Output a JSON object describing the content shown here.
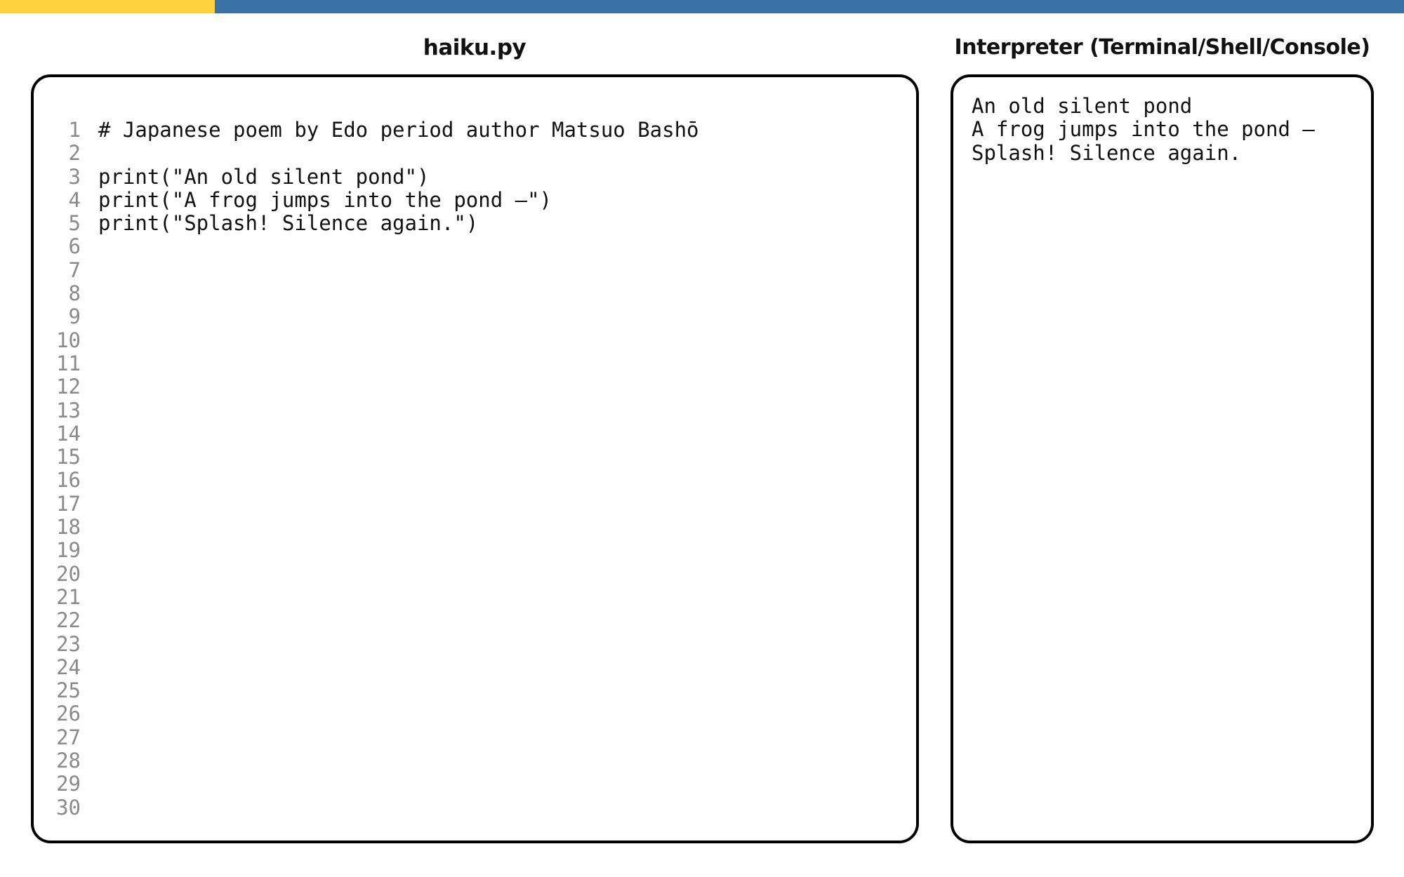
{
  "colors": {
    "top_bar": "#3a72a6",
    "top_bar_accent": "#fdd23d",
    "panel_border": "#000000",
    "line_number": "#8a8a8a",
    "text": "#111111"
  },
  "editor": {
    "title": "haiku.py",
    "lines": [
      {
        "num": "1",
        "code": "# Japanese poem by Edo period author Matsuo Bashō"
      },
      {
        "num": "2",
        "code": ""
      },
      {
        "num": "3",
        "code": "print(\"An old silent pond\")"
      },
      {
        "num": "4",
        "code": "print(\"A frog jumps into the pond —\")"
      },
      {
        "num": "5",
        "code": "print(\"Splash! Silence again.\")"
      },
      {
        "num": "6",
        "code": ""
      },
      {
        "num": "7",
        "code": ""
      },
      {
        "num": "8",
        "code": ""
      },
      {
        "num": "9",
        "code": ""
      },
      {
        "num": "10",
        "code": ""
      },
      {
        "num": "11",
        "code": ""
      },
      {
        "num": "12",
        "code": ""
      },
      {
        "num": "13",
        "code": ""
      },
      {
        "num": "14",
        "code": ""
      },
      {
        "num": "15",
        "code": ""
      },
      {
        "num": "16",
        "code": ""
      },
      {
        "num": "17",
        "code": ""
      },
      {
        "num": "18",
        "code": ""
      },
      {
        "num": "19",
        "code": ""
      },
      {
        "num": "20",
        "code": ""
      },
      {
        "num": "21",
        "code": ""
      },
      {
        "num": "22",
        "code": ""
      },
      {
        "num": "23",
        "code": ""
      },
      {
        "num": "24",
        "code": ""
      },
      {
        "num": "25",
        "code": ""
      },
      {
        "num": "26",
        "code": ""
      },
      {
        "num": "27",
        "code": ""
      },
      {
        "num": "28",
        "code": ""
      },
      {
        "num": "29",
        "code": ""
      },
      {
        "num": "30",
        "code": ""
      }
    ]
  },
  "console": {
    "title": "Interpreter (Terminal/Shell/Console)",
    "output": [
      "An old silent pond",
      "A frog jumps into the pond —",
      "Splash! Silence again."
    ]
  }
}
